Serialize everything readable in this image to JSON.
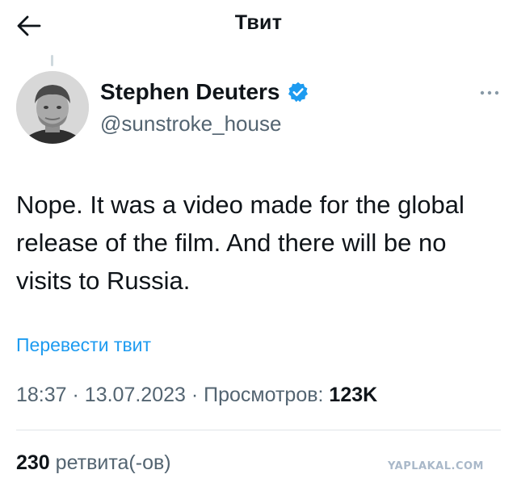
{
  "header": {
    "back_icon": "arrow-left-icon",
    "title": "Твит"
  },
  "tweet": {
    "author": {
      "name": "Stephen Deuters",
      "handle": "@sunstroke_house",
      "verified": true,
      "verified_icon": "verified-badge-icon",
      "verified_color": "#1d9bf0"
    },
    "more_icon": "more-dots-icon",
    "text": "Nope. It was a video made for the global release of the film. And there will be no visits to Russia.",
    "translate_label": "Перевести твит",
    "time": "18:37",
    "separator": "·",
    "date": "13.07.2023",
    "views_label": "Просмотров:",
    "views_count": "123K"
  },
  "stats": {
    "retweets_count": "230",
    "retweets_label": "ретвита(-ов)"
  },
  "watermark": "YAPLAKAL.COM",
  "colors": {
    "accent": "#1d9bf0",
    "secondary_text": "#536471",
    "primary_text": "#0f1419"
  }
}
